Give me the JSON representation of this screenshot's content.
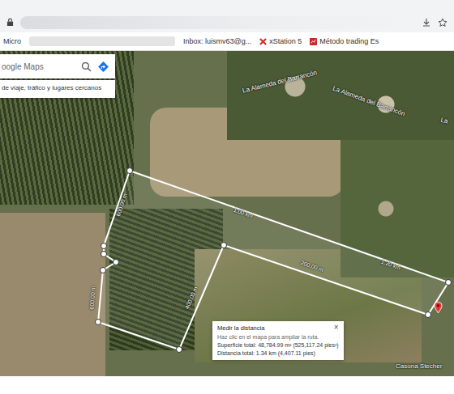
{
  "browser": {
    "bookmarks": [
      {
        "label": "Micro",
        "kind": "plain"
      },
      {
        "label": "Inbox: luismv63@g...",
        "kind": "plain"
      },
      {
        "label": "xStation 5",
        "kind": "xstation"
      },
      {
        "label": "Método trading Es",
        "kind": "trading"
      }
    ]
  },
  "search": {
    "placeholder": "oogle Maps",
    "hint": "de viaje, tráfico y lugares cercanos"
  },
  "map": {
    "street_labels": [
      "La Alameda del Barrancón",
      "La Alameda del Barrancón",
      "La"
    ],
    "place_labels": [
      "Casona Stecher"
    ]
  },
  "measurement": {
    "segments": [
      "600.00 m",
      "1.00 km",
      "1.20 km",
      "200.00 m",
      "400.00 m",
      "600.00 m"
    ],
    "popup": {
      "title": "Medir la distancia",
      "hint": "Haz clic en el mapa para ampliar la ruta.",
      "area": "Superficie total: 48,784.99 m² (525,117.24 pies²)",
      "distance": "Distancia total: 1.34 km (4,407.11 pies)",
      "close": "×"
    }
  }
}
